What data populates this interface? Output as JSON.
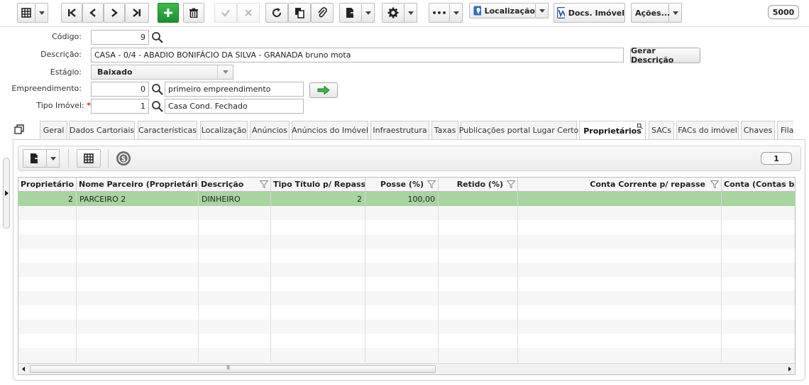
{
  "toolbar": {
    "localizacao_label": "Localização",
    "docs_imovel_label": "Docs. Imóvel",
    "acoes_label": "Ações...",
    "record_counter": "5000",
    "more_label": "•••"
  },
  "form": {
    "codigo": {
      "label": "Código:",
      "value": "9"
    },
    "descricao": {
      "label": "Descrição:",
      "value": "CASA - 0/4 - ABADIO BONIFÁCIO DA SILVA - GRANADA bruno mota",
      "button": "Gerar Descrição"
    },
    "estagio": {
      "label": "Estágio:",
      "value": "Baixado"
    },
    "empreendimento": {
      "label": "Empreendimento:",
      "code": "0",
      "name": "primeiro empreendimento"
    },
    "tipo_imovel": {
      "label": "Tipo Imóvel:",
      "required_mark": "*",
      "code": "1",
      "name": "Casa Cond. Fechado"
    }
  },
  "tabs": [
    {
      "label": "Geral"
    },
    {
      "label": "Dados Cartoriais"
    },
    {
      "label": "Características"
    },
    {
      "label": "Localização"
    },
    {
      "label": "Anúncios"
    },
    {
      "label": "Anúncios do Imóvel"
    },
    {
      "label": "Infraestrutura"
    },
    {
      "label": "Taxas"
    },
    {
      "label": "Publicações portal Lugar Certo"
    },
    {
      "label": "Proprietários",
      "active": true
    },
    {
      "label": "SACs"
    },
    {
      "label": "FACs do imóvel"
    },
    {
      "label": "Chaves"
    },
    {
      "label": "Fila"
    }
  ],
  "subtoolbar": {
    "page_counter": "1"
  },
  "grid": {
    "columns": [
      "Proprietário",
      "Nome Parceiro (Proprietário)",
      "Descrição",
      "Tipo Título p/ Repasse",
      "Posse (%)",
      "Retido (%)",
      "Conta Corrente p/ repasse",
      "Conta (Contas bancárias)"
    ],
    "rows": [
      {
        "proprietario": "2",
        "nome": "PARCEIRO 2",
        "descricao": "DINHEIRO",
        "tipo_titulo": "2",
        "posse": "100,00",
        "retido": "",
        "conta_corrente": "",
        "conta": ""
      }
    ],
    "scroll_grip": "III"
  }
}
